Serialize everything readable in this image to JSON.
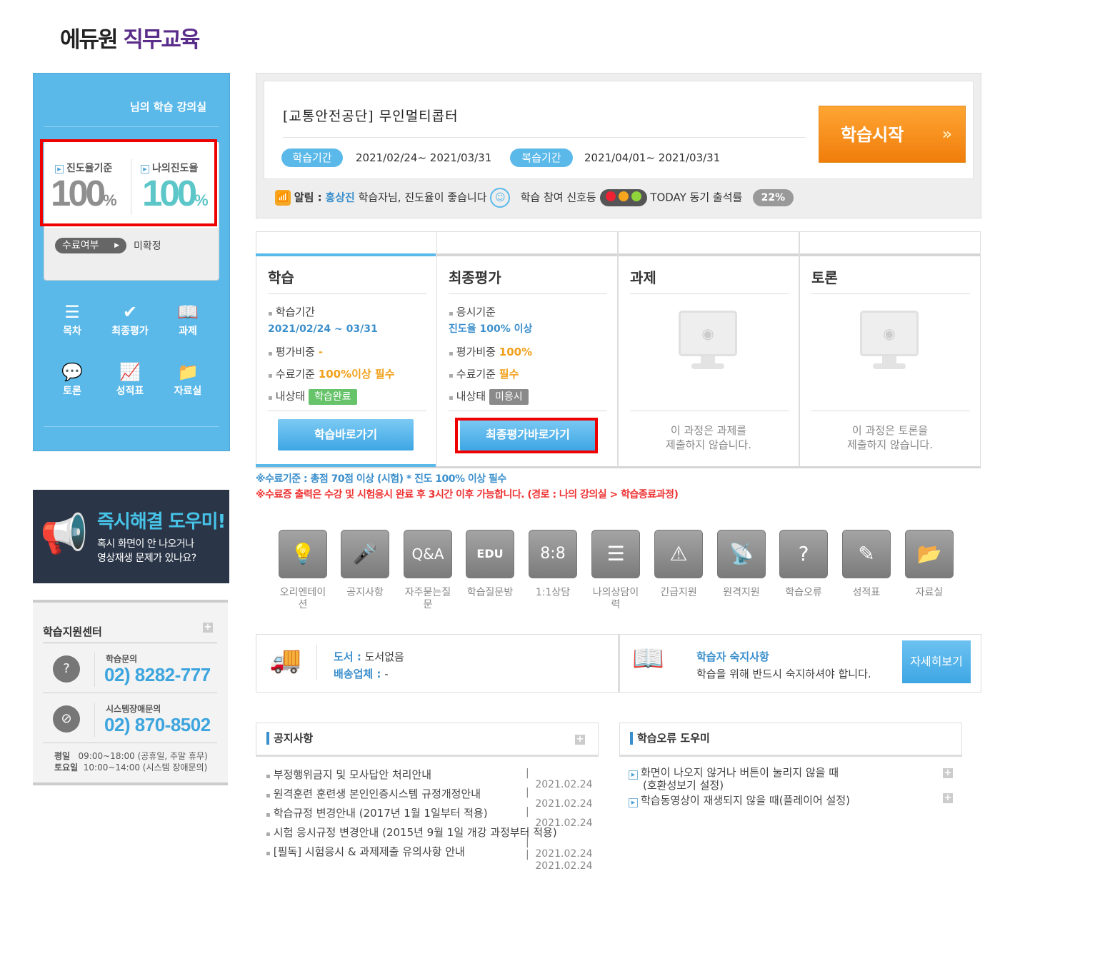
{
  "logo": {
    "part1": "에듀원",
    "part2": "직무교육"
  },
  "left_panel": {
    "title": "님의 학습 강의실",
    "progress_standard_label": "진도율기준",
    "progress_standard_value": "100",
    "my_progress_label": "나의진도율",
    "my_progress_value": "100",
    "percent_unit": "%",
    "completion_label": "수료여부",
    "completion_value": "미확정",
    "menu": [
      {
        "label": "목차",
        "icon": "list-icon"
      },
      {
        "label": "최종평가",
        "icon": "check-icon"
      },
      {
        "label": "과제",
        "icon": "book-icon"
      },
      {
        "label": "토론",
        "icon": "chat-icon"
      },
      {
        "label": "성적표",
        "icon": "chart-icon"
      },
      {
        "label": "자료실",
        "icon": "folder-icon"
      }
    ]
  },
  "banner": {
    "title": "즉시해결 도우미!",
    "line1": "혹시 화면이 안 나오거나",
    "line2": "영상재생 문제가 있나요?"
  },
  "support": {
    "title": "학습지원센터",
    "study_label": "학습문의",
    "study_phone": "02) 8282-777",
    "system_label": "시스템장애문의",
    "system_phone": "02) 870-8502",
    "weekday_label": "평일",
    "weekday_hours": "09:00~18:00 (공휴일, 주말 휴무)",
    "saturday_label": "토요일",
    "saturday_hours": "10:00~14:00 (시스템 장애문의)"
  },
  "course": {
    "title": "[교통안전공단] 무인멀티콥터",
    "study_period_label": "학습기간",
    "study_period": "2021/02/24~ 2021/03/31",
    "review_period_label": "복습기간",
    "review_period": "2021/04/01~ 2021/03/31",
    "start_button": "학습시작",
    "start_arrow": "»",
    "notice_label": "알림 :",
    "notice_name": "홍상진",
    "notice_text": "학습자님, 진도율이 좋습니다",
    "signal_label": "학습 참여 신호등",
    "today_label": "TODAY 동기 출석률",
    "today_rate": "22%"
  },
  "columns": {
    "study": {
      "title": "학습",
      "period_label": "학습기간",
      "period": "2021/02/24 ~ 03/31",
      "weight_label": "평가비중",
      "weight": "-",
      "criteria_label": "수료기준",
      "criteria": "100%이상 필수",
      "status_label": "내상태",
      "status": "학습완료",
      "button": "학습바로가기"
    },
    "final": {
      "title": "최종평가",
      "exam_label": "응시기준",
      "exam": "진도율 100% 이상",
      "weight_label": "평가비중",
      "weight": "100%",
      "criteria_label": "수료기준",
      "criteria": "필수",
      "status_label": "내상태",
      "status": "미응시",
      "button": "최종평가바로가기"
    },
    "assignment": {
      "title": "과제",
      "line1": "이 과정은 과제를",
      "line2": "제출하지 않습니다."
    },
    "discussion": {
      "title": "토론",
      "line1": "이 과정은 토론을",
      "line2": "제출하지 않습니다."
    }
  },
  "notes": {
    "note1": "※수료기준 : 총점 70점 이상 (시험) * 진도 100% 이상 필수",
    "note2": "※수료증 출력은 수강 및 시험응시 완료 후 3시간 이후 가능합니다. (경로 : 나의 강의실 > 학습종료과정)"
  },
  "quick_icons": [
    {
      "label": "오리엔테이션",
      "icon": "lightbulb-icon",
      "glyph": "💡"
    },
    {
      "label": "공지사항",
      "icon": "microphone-icon",
      "glyph": "🎤"
    },
    {
      "label": "자주묻는질문",
      "icon": "qa-icon",
      "glyph": "Q&A"
    },
    {
      "label": "학습질문방",
      "icon": "edu-laptop-icon",
      "glyph": "EDU"
    },
    {
      "label": "1:1상담",
      "icon": "one-to-one-icon",
      "glyph": "8:8"
    },
    {
      "label": "나의상담이력",
      "icon": "history-list-icon",
      "glyph": "☰"
    },
    {
      "label": "긴급지원",
      "icon": "alarm-icon",
      "glyph": "⚠"
    },
    {
      "label": "원격지원",
      "icon": "satellite-icon",
      "glyph": "📡"
    },
    {
      "label": "학습오류",
      "icon": "error-question-icon",
      "glyph": "?"
    },
    {
      "label": "성적표",
      "icon": "grade-report-icon",
      "glyph": "✎"
    },
    {
      "label": "자료실",
      "icon": "upload-folder-icon",
      "glyph": "📂"
    }
  ],
  "book": {
    "book_label": "도서 :",
    "book_value": "도서없음",
    "ship_label": "배송업체 :",
    "ship_value": "-"
  },
  "learner_notice": {
    "title": "학습자 숙지사항",
    "text": "학습을 위해 반드시 숙지하셔야 합니다.",
    "button": "자세히보기"
  },
  "notice_board": {
    "title": "공지사항",
    "items": [
      {
        "title": "부정행위금지 및 모사답안 처리안내",
        "date": "2021.02.24"
      },
      {
        "title": "원격훈련 훈련생 본인인증시스템 규정개정안내",
        "date": "2021.02.24"
      },
      {
        "title": "학습규정 변경안내 (2017년 1월 1일부터 적용)",
        "date": "2021.02.24"
      },
      {
        "title": "시험 응시규정 변경안내 (2015년 9월 1일 개강 과정부터 적용)",
        "date": "2021.02.24"
      },
      {
        "title": "[필독] 시험응시 & 과제제출 유의사항 안내",
        "date": "2021.02.24"
      }
    ]
  },
  "error_board": {
    "title": "학습오류 도우미",
    "items": [
      {
        "line1": "화면이 나오지 않거나 버튼이 눌리지 않을 때",
        "line2": "(호환성보기 설정)"
      },
      {
        "line1": "학습동영상이 재생되지 않을 때(플레이어 설정)"
      }
    ]
  },
  "colors": {
    "accent_blue": "#5bb9ea",
    "orange": "#f08a12",
    "highlight_red": "#e00000",
    "teal": "#5cc6c8"
  }
}
